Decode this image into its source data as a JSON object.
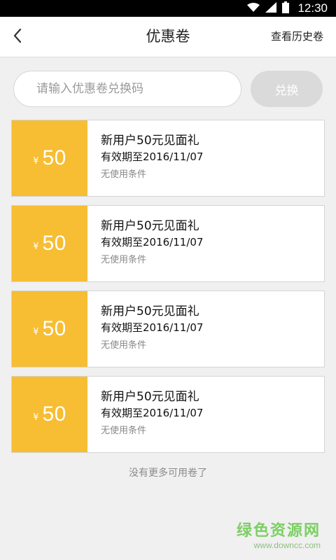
{
  "status_bar": {
    "time": "12:30",
    "icons": [
      "wifi-icon",
      "signal-icon",
      "battery-icon"
    ]
  },
  "header": {
    "title": "优惠卷",
    "history_link": "查看历史卷",
    "back_icon": "chevron-left-icon"
  },
  "redeem": {
    "placeholder": "请输入优惠卷兑换码",
    "value": "",
    "button_label": "兑换"
  },
  "coupons": [
    {
      "currency": "¥",
      "amount": "50",
      "title": "新用户50元见面礼",
      "expiry": "有效期至2016/11/07",
      "condition": "无使用条件"
    },
    {
      "currency": "¥",
      "amount": "50",
      "title": "新用户50元见面礼",
      "expiry": "有效期至2016/11/07",
      "condition": "无使用条件"
    },
    {
      "currency": "¥",
      "amount": "50",
      "title": "新用户50元见面礼",
      "expiry": "有效期至2016/11/07",
      "condition": "无使用条件"
    },
    {
      "currency": "¥",
      "amount": "50",
      "title": "新用户50元见面礼",
      "expiry": "有效期至2016/11/07",
      "condition": "无使用条件"
    }
  ],
  "footer": {
    "no_more_text": "没有更多可用卷了"
  },
  "watermark": {
    "name": "绿色资源网",
    "url": "www.downcc.com"
  },
  "colors": {
    "accent": "#f7bd33",
    "background": "#f0f0f0",
    "button_disabled": "#dadada",
    "watermark": "#7ccf63"
  }
}
